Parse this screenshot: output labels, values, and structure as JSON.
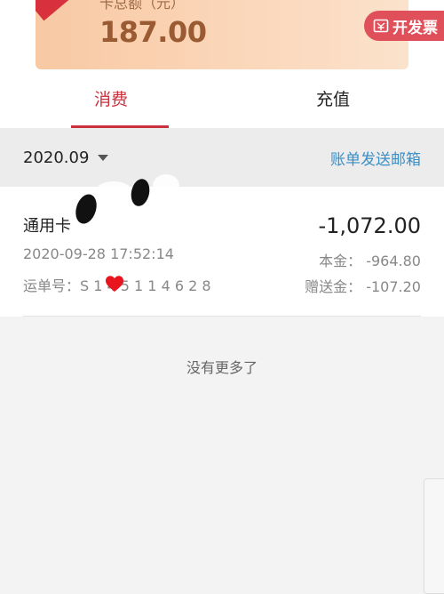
{
  "balance_card": {
    "label": "卡总额（元）",
    "amount": "187.00",
    "invoice_button_label": "开发票"
  },
  "tabs": [
    {
      "label": "消费",
      "active": true
    },
    {
      "label": "充值",
      "active": false
    }
  ],
  "filter": {
    "month": "2020.09",
    "send_email_label": "账单发送邮箱"
  },
  "transaction": {
    "title": "通用卡",
    "time": "2020-09-28 17:52:14",
    "waybill": "运单号：S 1  4 5 1 1 4 6 2 8",
    "amount": "-1,072.00",
    "principal": "本金：  -964.80",
    "bonus": "赠送金：  -107.20"
  },
  "footer": {
    "no_more": "没有更多了"
  },
  "colors": {
    "accent_red": "#c9313c",
    "link_blue": "#3a8fc7",
    "card_gold": "#9a5a32"
  }
}
